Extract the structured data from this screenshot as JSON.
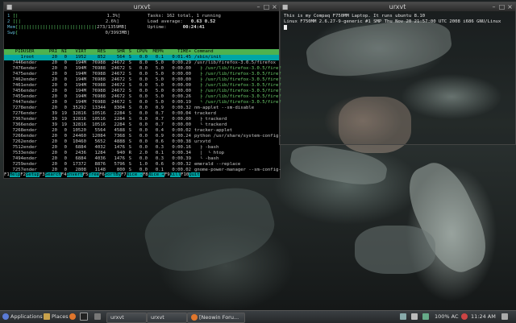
{
  "htop": {
    "title": "urxvt",
    "meters": [
      {
        "label": "1",
        "bar": "[|",
        "value": "1.3%]"
      },
      {
        "label": "2",
        "bar": "[||",
        "value": "2.6%]"
      },
      {
        "label": "Mem",
        "bar": "[|||||||||||||||||||||||||||||",
        "value": "273/1359MB]"
      },
      {
        "label": "Swp",
        "bar": "[",
        "value": "0/3993MB]"
      }
    ],
    "tasks_text": "Tasks: 162 total, 1 running",
    "load_label": "Load average:",
    "load_value": "0.63 0.52",
    "uptime_label": "Uptime:",
    "uptime_value": "00:24:41",
    "columns": [
      "PID",
      "USER",
      "PRI",
      "NI",
      "VIRT",
      "RES",
      "SHR",
      "S",
      "CPU%",
      "MEM%",
      "TIME+",
      "Command"
    ],
    "rows": [
      [
        "1",
        "root",
        "20",
        "0",
        "1952",
        "852",
        "564",
        "S",
        "0.0",
        "0.1",
        "0:01.45",
        "/sbin/init"
      ],
      [
        "7446",
        "ender",
        "20",
        "0",
        "194M",
        "76988",
        "24672",
        "S",
        "8.0",
        "5.0",
        "0:00.29",
        "/usr/lib/firefox-3.0.5/firefox"
      ],
      [
        "7476",
        "ender",
        "20",
        "0",
        "194M",
        "76988",
        "24672",
        "S",
        "0.0",
        "5.0",
        "0:00.00",
        "/usr/lib/firefox-3.0.5/firef"
      ],
      [
        "7475",
        "ender",
        "20",
        "0",
        "194M",
        "76988",
        "24672",
        "S",
        "0.0",
        "5.0",
        "0:00.00",
        "/usr/lib/firefox-3.0.5/firef"
      ],
      [
        "7462",
        "ender",
        "20",
        "0",
        "194M",
        "76988",
        "24672",
        "S",
        "0.0",
        "5.0",
        "0:00.00",
        "/usr/lib/firefox-3.0.5/firef"
      ],
      [
        "7461",
        "ender",
        "20",
        "0",
        "194M",
        "76988",
        "24672",
        "S",
        "0.0",
        "5.0",
        "0:00.00",
        "/usr/lib/firefox-3.0.5/firef"
      ],
      [
        "7456",
        "ender",
        "20",
        "0",
        "194M",
        "76988",
        "24672",
        "S",
        "0.0",
        "5.0",
        "0:00.00",
        "/usr/lib/firefox-3.0.5/firef"
      ],
      [
        "7455",
        "ender",
        "20",
        "0",
        "194M",
        "76988",
        "24672",
        "S",
        "0.0",
        "5.0",
        "0:00.26",
        "/usr/lib/firefox-3.0.5/firef"
      ],
      [
        "7447",
        "ender",
        "20",
        "0",
        "194M",
        "76988",
        "24672",
        "S",
        "0.0",
        "5.0",
        "0:00.19",
        "/usr/lib/firefox-3.0.5/firef"
      ],
      [
        "7278",
        "ender",
        "20",
        "0",
        "35292",
        "13344",
        "8304",
        "S",
        "0.0",
        "0.9",
        "0:00.32",
        "nm-applet --sm-disable"
      ],
      [
        "7276",
        "ender",
        "39",
        "19",
        "32816",
        "10516",
        "2284",
        "S",
        "0.0",
        "0.7",
        "0:00.04",
        "trackerd"
      ],
      [
        "7367",
        "ender",
        "39",
        "19",
        "32816",
        "10516",
        "2284",
        "S",
        "0.0",
        "0.7",
        "0:00.00",
        "trackerd"
      ],
      [
        "7366",
        "ender",
        "39",
        "19",
        "32816",
        "10516",
        "2284",
        "S",
        "0.0",
        "0.7",
        "0:00.00",
        "trackerd"
      ],
      [
        "7268",
        "ender",
        "20",
        "0",
        "10520",
        "5564",
        "4588",
        "S",
        "0.0",
        "0.4",
        "0:00.02",
        "tracker-applet"
      ],
      [
        "7266",
        "ender",
        "20",
        "0",
        "24460",
        "12084",
        "7368",
        "S",
        "0.0",
        "0.9",
        "0:00.24",
        "python /usr/share/system-config-"
      ],
      [
        "7262",
        "ender",
        "20",
        "0",
        "10460",
        "5652",
        "4888",
        "S",
        "0.0",
        "0.6",
        "0:00.38",
        "urxvtd"
      ],
      [
        "7512",
        "ender",
        "20",
        "0",
        "6884",
        "4032",
        "1476",
        "S",
        "0.0",
        "0.3",
        "0:00.16",
        "-bash"
      ],
      [
        "7533",
        "ender",
        "20",
        "0",
        "2436",
        "1284",
        "940",
        "R",
        "2.0",
        "0.1",
        "0:00.34",
        "htop"
      ],
      [
        "7494",
        "ender",
        "20",
        "0",
        "6884",
        "4036",
        "1476",
        "S",
        "0.0",
        "0.3",
        "0:00.39",
        "-bash"
      ],
      [
        "7259",
        "ender",
        "20",
        "0",
        "17372",
        "8876",
        "5796",
        "S",
        "1.0",
        "0.6",
        "0:00.32",
        "emerald --replace"
      ],
      [
        "7257",
        "ender",
        "20",
        "0",
        "2808",
        "1148",
        "800",
        "S",
        "0.0",
        "0.1",
        "0:00.02",
        "gnome-power-manager --sm-config-"
      ]
    ],
    "tree_prefixes": [
      "",
      "",
      "  ├ ",
      "  ├ ",
      "  ├ ",
      "  ├ ",
      "  ├ ",
      "  ├ ",
      "  └ ",
      "",
      "",
      "  ├ ",
      "  └ ",
      "",
      "",
      "",
      "  ├ ",
      "  │  └ ",
      "  └ ",
      "",
      ""
    ],
    "fkeys": [
      {
        "key": "F1",
        "label": "Help"
      },
      {
        "key": "F2",
        "label": "Setup"
      },
      {
        "key": "F3",
        "label": "Search"
      },
      {
        "key": "F4",
        "label": "Invert"
      },
      {
        "key": "F5",
        "label": "Tree"
      },
      {
        "key": "F6",
        "label": "SortBy"
      },
      {
        "key": "F7",
        "label": "Nice -"
      },
      {
        "key": "F8",
        "label": "Nice +"
      },
      {
        "key": "F9",
        "label": "Kill"
      },
      {
        "key": "F10",
        "label": "Quit"
      }
    ]
  },
  "term2": {
    "title": "urxvt",
    "line1": "This is my Compaq F750MM Laptop. It runs ubuntu 8.10",
    "line2": "Linux F750MM 2.6.27-9-generic #1 SMP Thu Nov 20 21:57:00 UTC 2008 i686 GNU/Linux"
  },
  "taskbar": {
    "applications": "Applications",
    "places": "Places",
    "tasks": [
      "urxvt",
      "urxvt",
      "[Neowin Foru..."
    ],
    "battery": "100% AC",
    "clock": "11:24 AM"
  },
  "colors": {
    "htop_header": "#4fb24f",
    "selection": "#00a6a6",
    "meter_bar": "#5fd36a"
  }
}
